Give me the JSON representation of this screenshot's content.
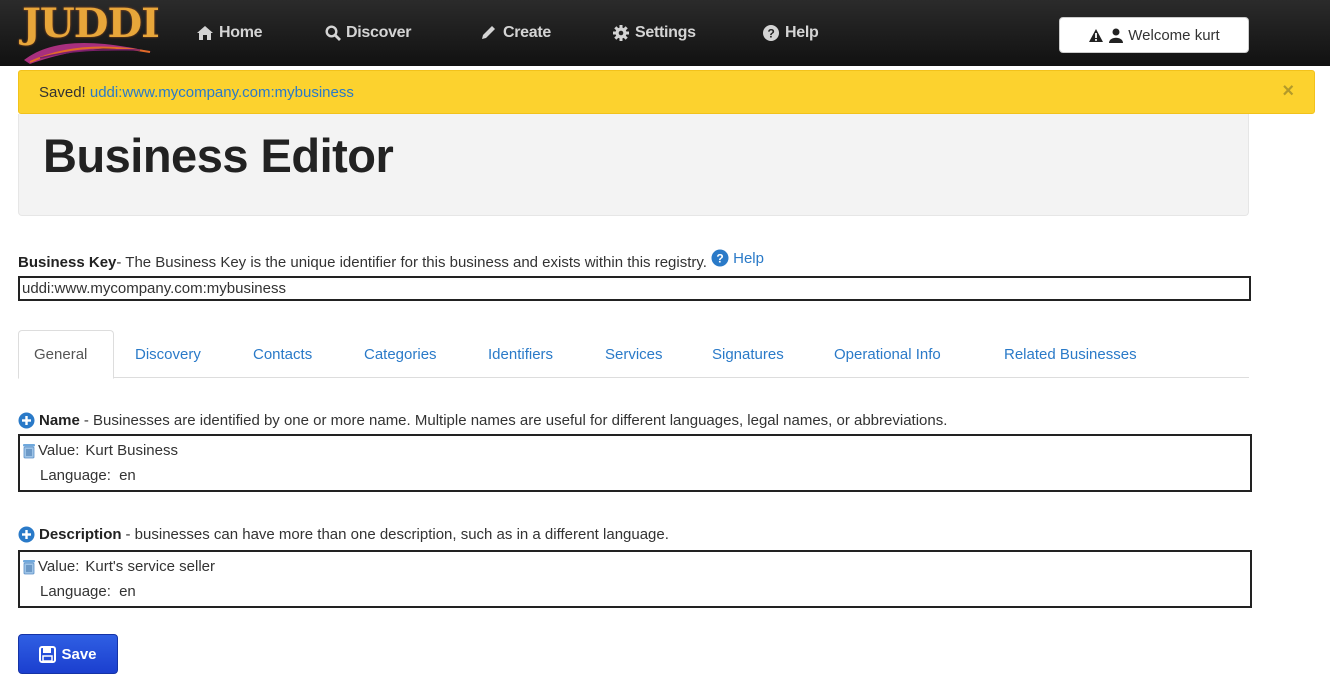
{
  "navbar": {
    "brand": "JUDDI",
    "items": [
      {
        "label": "Home",
        "icon": "home-icon"
      },
      {
        "label": "Discover",
        "icon": "search-icon"
      },
      {
        "label": "Create",
        "icon": "pencil-icon"
      },
      {
        "label": "Settings",
        "icon": "gear-icon"
      },
      {
        "label": "Help",
        "icon": "question-icon"
      }
    ],
    "welcome_label": "Welcome kurt"
  },
  "alert": {
    "prefix": "Saved!",
    "link": "uddi:www.mycompany.com:mybusiness",
    "close": "×"
  },
  "page_title": "Business Editor",
  "business_key": {
    "label": "Business Key",
    "description": "- The Business Key is the unique identifier for this business and exists within this registry.",
    "help_label": "Help",
    "value": "uddi:www.mycompany.com:mybusiness"
  },
  "tabs": [
    {
      "label": "General",
      "active": true
    },
    {
      "label": "Discovery"
    },
    {
      "label": "Contacts"
    },
    {
      "label": "Categories"
    },
    {
      "label": "Identifiers"
    },
    {
      "label": "Services"
    },
    {
      "label": "Signatures"
    },
    {
      "label": "Operational Info"
    },
    {
      "label": "Related Businesses"
    }
  ],
  "name_section": {
    "title": "Name",
    "description": "- Businesses are identified by one or more name. Multiple names are useful for different languages, legal names, or abbreviations.",
    "value_label": "Value:",
    "value": "Kurt Business",
    "language_label": "Language:",
    "language": "en"
  },
  "description_section": {
    "title": "Description",
    "description": "- businesses can have more than one description, such as in a different language.",
    "value_label": "Value:",
    "value": "Kurt's service seller",
    "language_label": "Language:",
    "language": "en"
  },
  "save_label": "Save",
  "colors": {
    "navbar": "#1a1a1a",
    "alert": "#fcd22e",
    "link": "#2a7ac8",
    "save_button": "#2a52dc"
  }
}
